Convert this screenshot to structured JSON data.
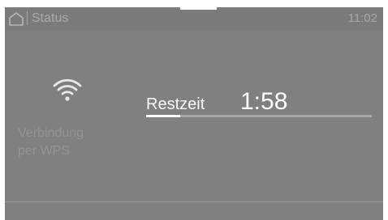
{
  "header": {
    "title": "Status",
    "time": "11:02",
    "home_icon": "home-icon"
  },
  "sidebar": {
    "wifi_icon": "wifi-icon",
    "wps_label_line1": "Verbindung",
    "wps_label_line2": "per WPS"
  },
  "main": {
    "remaining_label": "Restzeit",
    "remaining_value": "1:58",
    "progress_percent": 15
  }
}
